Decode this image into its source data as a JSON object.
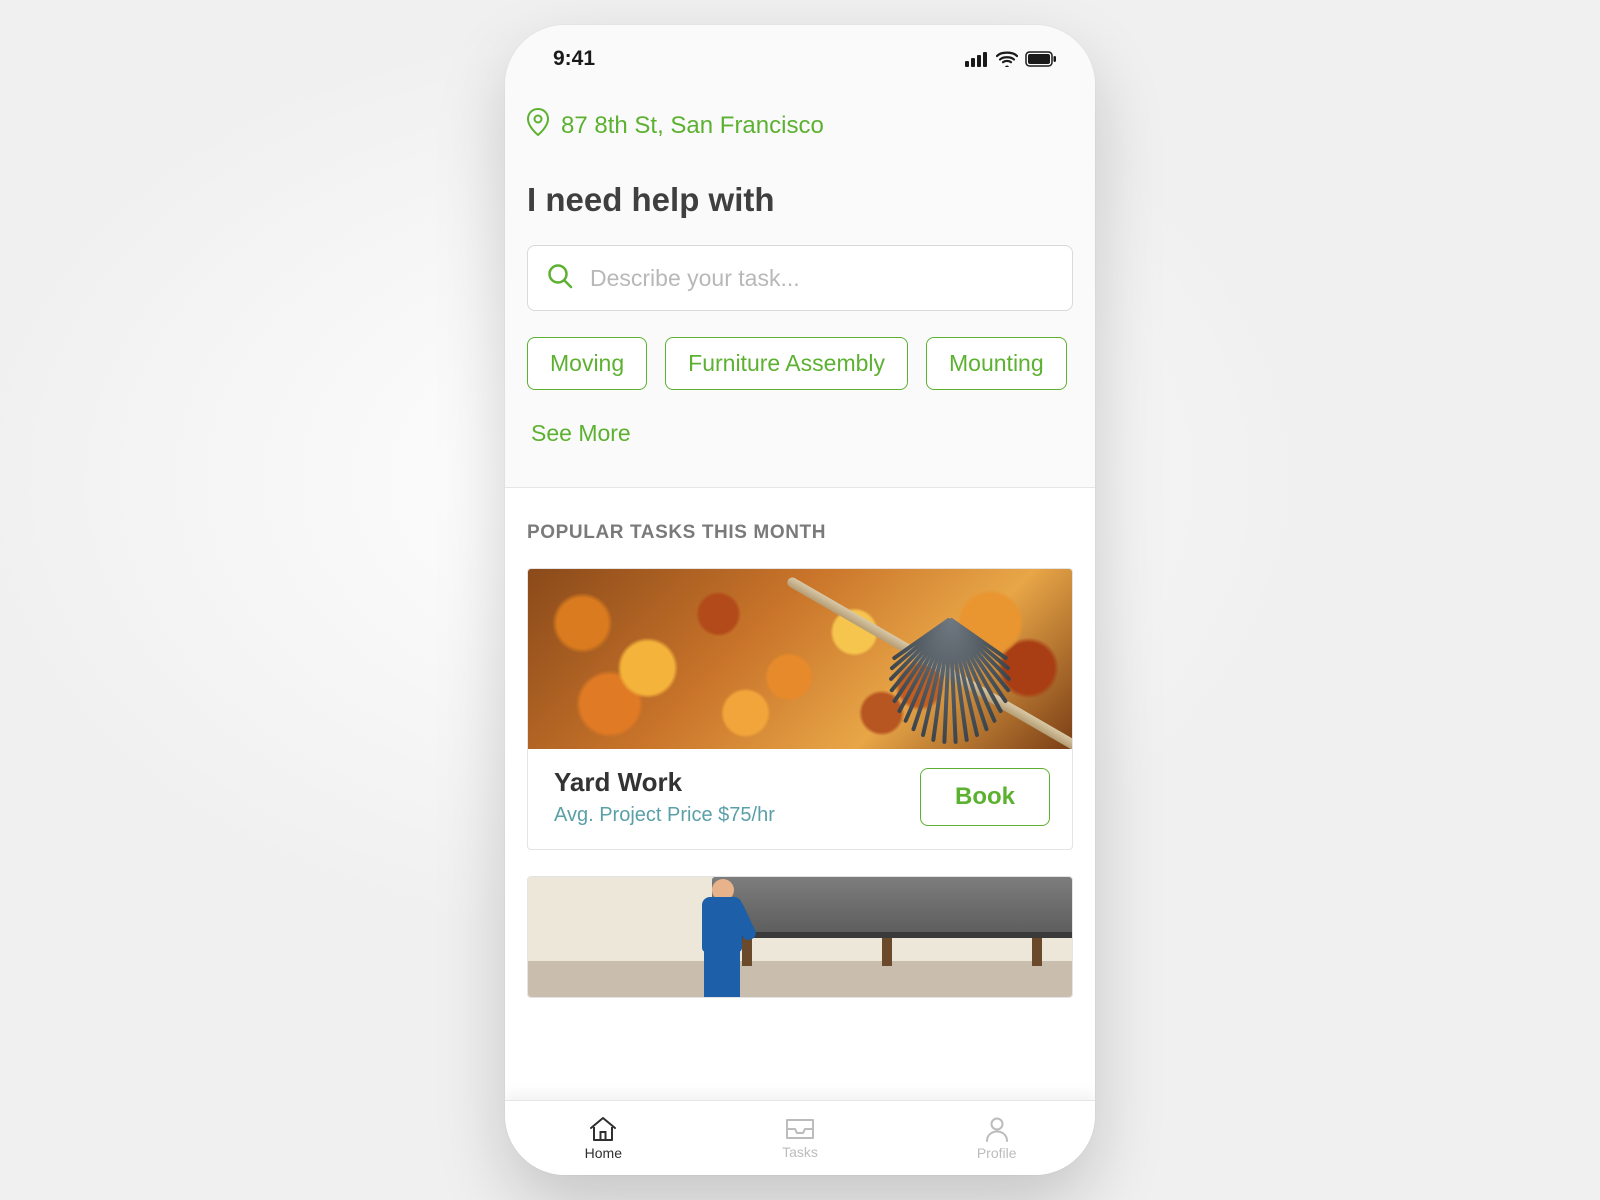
{
  "colors": {
    "accent": "#5db131",
    "subtle": "#5aa0a7"
  },
  "status": {
    "time": "9:41"
  },
  "location": {
    "address": "87 8th St, San Francisco"
  },
  "heading": "I need help with",
  "search": {
    "placeholder": "Describe your task..."
  },
  "chips": [
    {
      "label": "Moving"
    },
    {
      "label": "Furniture Assembly"
    },
    {
      "label": "Mounting"
    }
  ],
  "see_more": "See More",
  "popular": {
    "title": "POPULAR TASKS THIS MONTH",
    "cards": [
      {
        "title": "Yard Work",
        "subtitle": "Avg. Project Price $75/hr",
        "action": "Book"
      }
    ]
  },
  "tabs": [
    {
      "label": "Home",
      "active": true
    },
    {
      "label": "Tasks",
      "active": false
    },
    {
      "label": "Profile",
      "active": false
    }
  ]
}
